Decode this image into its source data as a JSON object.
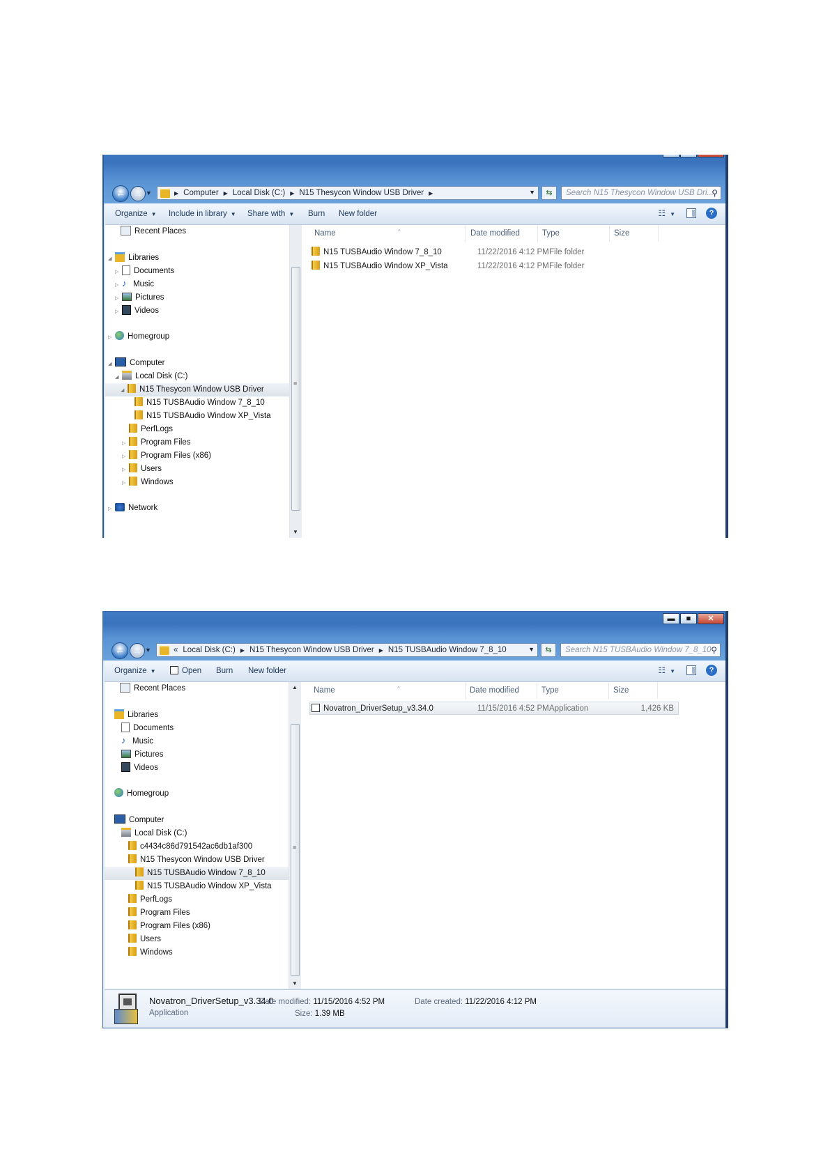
{
  "window1": {
    "controls": {
      "minimize": "▬",
      "maximize": "■",
      "close": "✕"
    },
    "address": {
      "crumbs": [
        "Computer",
        "Local Disk (C:)",
        "N15 Thesycon Window USB Driver"
      ]
    },
    "search_placeholder": "Search N15 Thesycon Window USB Dri...",
    "toolbar": {
      "organize": "Organize",
      "include": "Include in library",
      "share": "Share with",
      "burn": "Burn",
      "new_folder": "New folder"
    },
    "nav": {
      "recent": "Recent Places",
      "libraries": "Libraries",
      "documents": "Documents",
      "music": "Music",
      "pictures": "Pictures",
      "videos": "Videos",
      "homegroup": "Homegroup",
      "computer": "Computer",
      "local_disk": "Local Disk (C:)",
      "driver": "N15 Thesycon Window USB Driver",
      "sub1": "N15 TUSBAudio Window 7_8_10",
      "sub2": "N15 TUSBAudio Window XP_Vista",
      "perflogs": "PerfLogs",
      "program_files": "Program Files",
      "program_files_x86": "Program Files (x86)",
      "users": "Users",
      "windows": "Windows",
      "network": "Network"
    },
    "columns": {
      "name": "Name",
      "date": "Date modified",
      "type": "Type",
      "size": "Size"
    },
    "files": [
      {
        "name": "N15 TUSBAudio Window 7_8_10",
        "date": "11/22/2016 4:12 PM",
        "type": "File folder",
        "size": ""
      },
      {
        "name": "N15 TUSBAudio Window XP_Vista",
        "date": "11/22/2016 4:12 PM",
        "type": "File folder",
        "size": ""
      }
    ]
  },
  "window2": {
    "controls": {
      "minimize": "▬",
      "maximize": "■",
      "close": "✕"
    },
    "address": {
      "overflow": "«",
      "crumbs": [
        "Local Disk (C:)",
        "N15 Thesycon Window USB Driver",
        "N15 TUSBAudio Window 7_8_10"
      ]
    },
    "search_placeholder": "Search N15 TUSBAudio Window 7_8_10",
    "toolbar": {
      "organize": "Organize",
      "open": "Open",
      "burn": "Burn",
      "new_folder": "New folder"
    },
    "nav": {
      "recent": "Recent Places",
      "libraries": "Libraries",
      "documents": "Documents",
      "music": "Music",
      "pictures": "Pictures",
      "videos": "Videos",
      "homegroup": "Homegroup",
      "computer": "Computer",
      "local_disk": "Local Disk (C:)",
      "hashfolder": "c4434c86d791542ac6db1af300",
      "driver": "N15 Thesycon Window USB Driver",
      "sub1": "N15 TUSBAudio Window 7_8_10",
      "sub2": "N15 TUSBAudio Window XP_Vista",
      "perflogs": "PerfLogs",
      "program_files": "Program Files",
      "program_files_x86": "Program Files (x86)",
      "users": "Users",
      "windows": "Windows"
    },
    "columns": {
      "name": "Name",
      "date": "Date modified",
      "type": "Type",
      "size": "Size"
    },
    "files": [
      {
        "name": "Novatron_DriverSetup_v3.34.0",
        "date": "11/15/2016 4:52 PM",
        "type": "Application",
        "size": "1,426 KB"
      }
    ],
    "details": {
      "name": "Novatron_DriverSetup_v3.34.0",
      "type": "Application",
      "date_modified_label": "Date modified:",
      "date_modified": "11/15/2016 4:52 PM",
      "date_created_label": "Date created:",
      "date_created": "11/22/2016 4:12 PM",
      "size_label": "Size:",
      "size": "1.39 MB"
    }
  }
}
